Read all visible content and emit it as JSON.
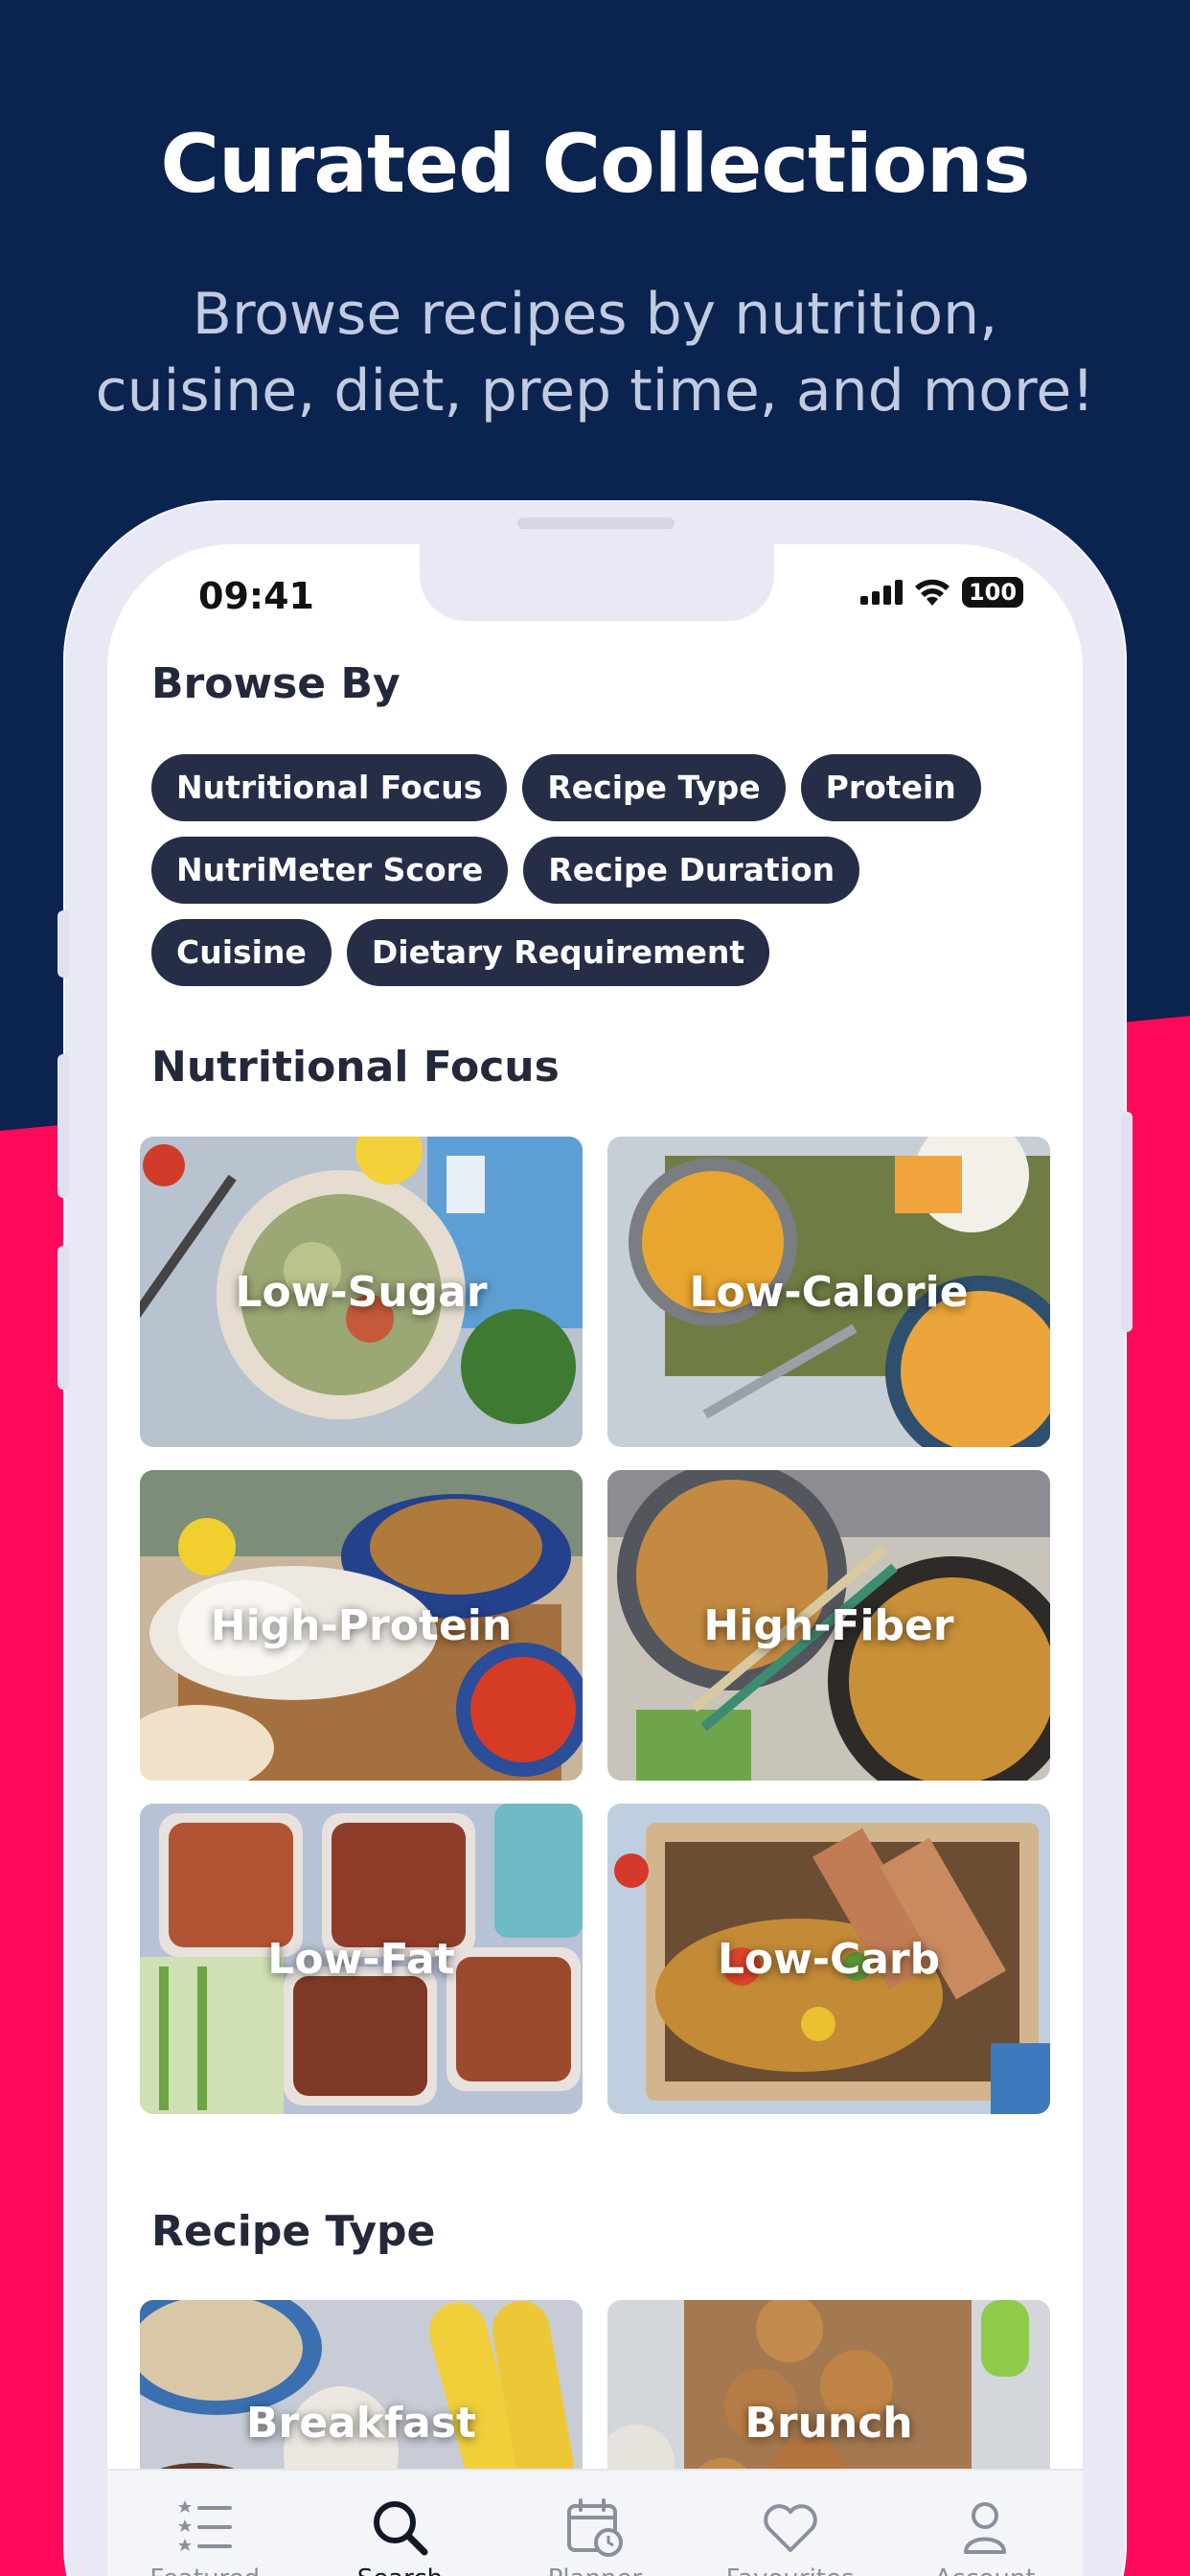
{
  "promo": {
    "headline": "Curated Collections",
    "subhead": "Browse recipes by nutrition, cuisine, diet, prep time, and more!"
  },
  "status_bar": {
    "time": "09:41",
    "battery": "100"
  },
  "browse": {
    "title": "Browse By",
    "chips": [
      "Nutritional Focus",
      "Recipe Type",
      "Protein",
      "NutriMeter Score",
      "Recipe Duration",
      "Cuisine",
      "Dietary Requirement"
    ]
  },
  "nutritional_focus": {
    "title": "Nutritional Focus",
    "tiles": [
      "Low-Sugar",
      "Low-Calorie",
      "High-Protein",
      "High-Fiber",
      "Low-Fat",
      "Low-Carb"
    ]
  },
  "recipe_type": {
    "title": "Recipe Type",
    "tiles": [
      "Breakfast",
      "Brunch"
    ]
  },
  "tab_bar": {
    "tabs": [
      {
        "label": "Featured",
        "icon": "list-stars-icon"
      },
      {
        "label": "Search",
        "icon": "search-icon"
      },
      {
        "label": "Planner",
        "icon": "calendar-clock-icon"
      },
      {
        "label": "Favourites",
        "icon": "heart-icon"
      },
      {
        "label": "Account",
        "icon": "person-icon"
      }
    ],
    "active": "Search"
  },
  "colors": {
    "navy_background": "#0b234f",
    "pink_background": "#ff0a5a",
    "chip_background": "#252d47",
    "tab_active": "#111827",
    "tab_inactive": "#8a8f9d"
  }
}
